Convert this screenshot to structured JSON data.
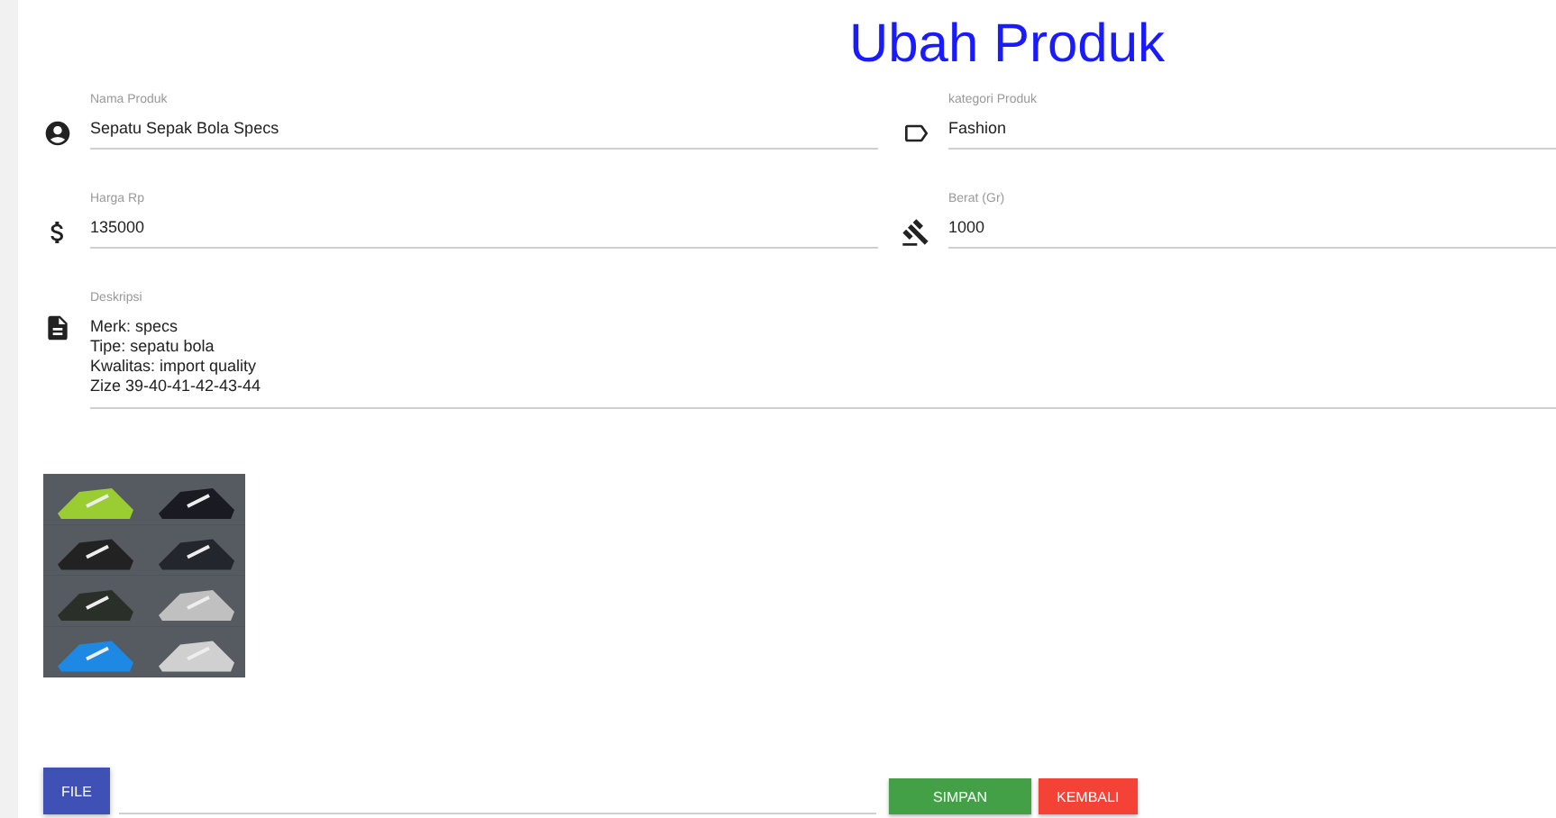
{
  "title": "Ubah Produk",
  "fields": [
    {
      "kind": "person",
      "label": "Nama Produk",
      "value": "Sepatu Sepak Bola Specs"
    },
    {
      "kind": "tag",
      "label": "kategori Produk",
      "value": "Fashion"
    },
    {
      "kind": "money",
      "label": "Harga Rp",
      "value": "135000"
    },
    {
      "kind": "gavel",
      "label": "Berat (Gr)",
      "value": "1000"
    }
  ],
  "description": {
    "label": "Deskripsi",
    "lines": [
      "Merk: specs",
      "Tipe: sepatu bola",
      "Kwalitas: import quality",
      "Zize 39-40-41-42-43-44"
    ]
  },
  "file_button": "FILE",
  "buttons": [
    {
      "kind": "save",
      "label": "SIMPAN"
    },
    {
      "kind": "back",
      "label": "KEMBALI"
    }
  ]
}
